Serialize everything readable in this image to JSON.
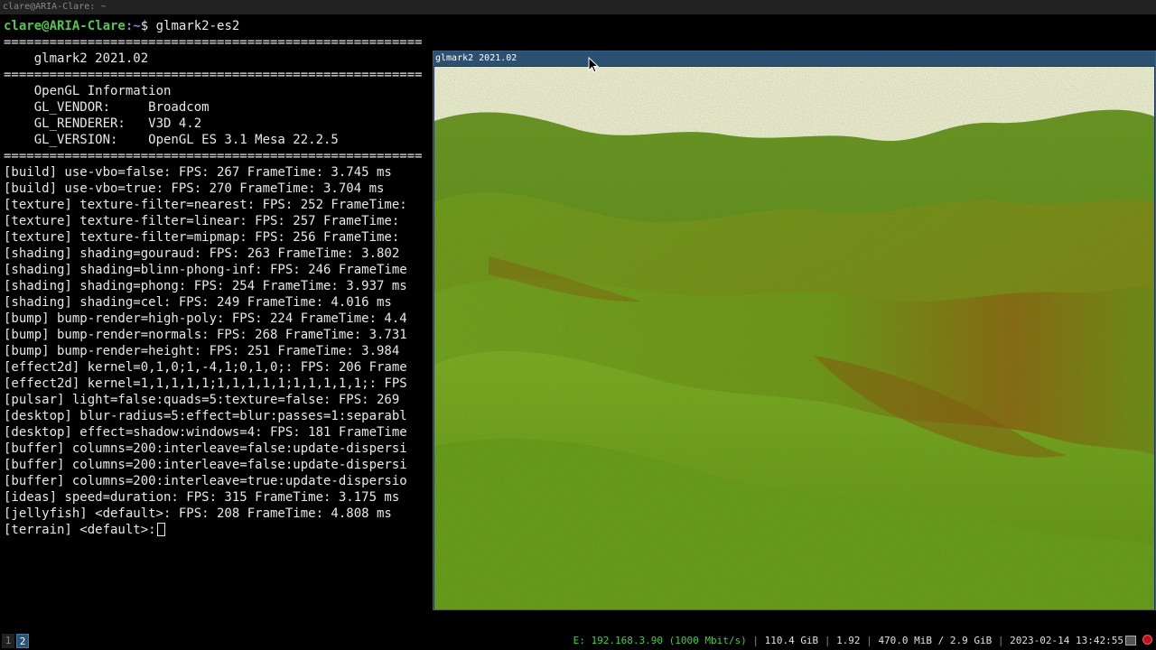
{
  "terminal": {
    "window_title": "clare@ARIA-Clare: ~",
    "prompt": {
      "user_host": "clare@ARIA-Clare",
      "path": ":~",
      "dollar": "$",
      "command": " glmark2-es2"
    },
    "separator": "=======================================================",
    "header": "    glmark2 2021.02",
    "info_lines": [
      "    OpenGL Information",
      "    GL_VENDOR:     Broadcom",
      "    GL_RENDERER:   V3D 4.2",
      "    GL_VERSION:    OpenGL ES 3.1 Mesa 22.2.5"
    ],
    "results": [
      "[build] use-vbo=false: FPS: 267 FrameTime: 3.745 ms",
      "[build] use-vbo=true: FPS: 270 FrameTime: 3.704 ms",
      "[texture] texture-filter=nearest: FPS: 252 FrameTime:",
      "[texture] texture-filter=linear: FPS: 257 FrameTime:",
      "[texture] texture-filter=mipmap: FPS: 256 FrameTime:",
      "[shading] shading=gouraud: FPS: 263 FrameTime: 3.802",
      "[shading] shading=blinn-phong-inf: FPS: 246 FrameTime",
      "[shading] shading=phong: FPS: 254 FrameTime: 3.937 ms",
      "[shading] shading=cel: FPS: 249 FrameTime: 4.016 ms",
      "[bump] bump-render=high-poly: FPS: 224 FrameTime: 4.4",
      "[bump] bump-render=normals: FPS: 268 FrameTime: 3.731",
      "[bump] bump-render=height: FPS: 251 FrameTime: 3.984",
      "[effect2d] kernel=0,1,0;1,-4,1;0,1,0;: FPS: 206 Frame",
      "[effect2d] kernel=1,1,1,1,1;1,1,1,1,1;1,1,1,1,1;: FPS",
      "[pulsar] light=false:quads=5:texture=false: FPS: 269",
      "[desktop] blur-radius=5:effect=blur:passes=1:separabl",
      "[desktop] effect=shadow:windows=4: FPS: 181 FrameTime",
      "[buffer] columns=200:interleave=false:update-dispersi",
      "[buffer] columns=200:interleave=false:update-dispersi",
      "[buffer] columns=200:interleave=true:update-dispersio",
      "[ideas] speed=duration: FPS: 315 FrameTime: 3.175 ms",
      "[jellyfish] <default>: FPS: 208 FrameTime: 4.808 ms"
    ],
    "current_line": "[terrain] <default>:"
  },
  "glmark_window": {
    "title": "glmark2 2021.02",
    "scene": "terrain",
    "sky_color": "#fbf8e6",
    "grass_color": "#5f9a1e"
  },
  "statusbar": {
    "workspaces": [
      "1",
      "2"
    ],
    "active_workspace": "2",
    "ethernet": "E: 192.168.3.90 (1000 Mbit/s)",
    "disk": "110.4 GiB",
    "load": "1.92",
    "memory": "470.0 MiB / 2.9 GiB",
    "datetime": "2023-02-14 13:42:55",
    "separator": "|"
  }
}
